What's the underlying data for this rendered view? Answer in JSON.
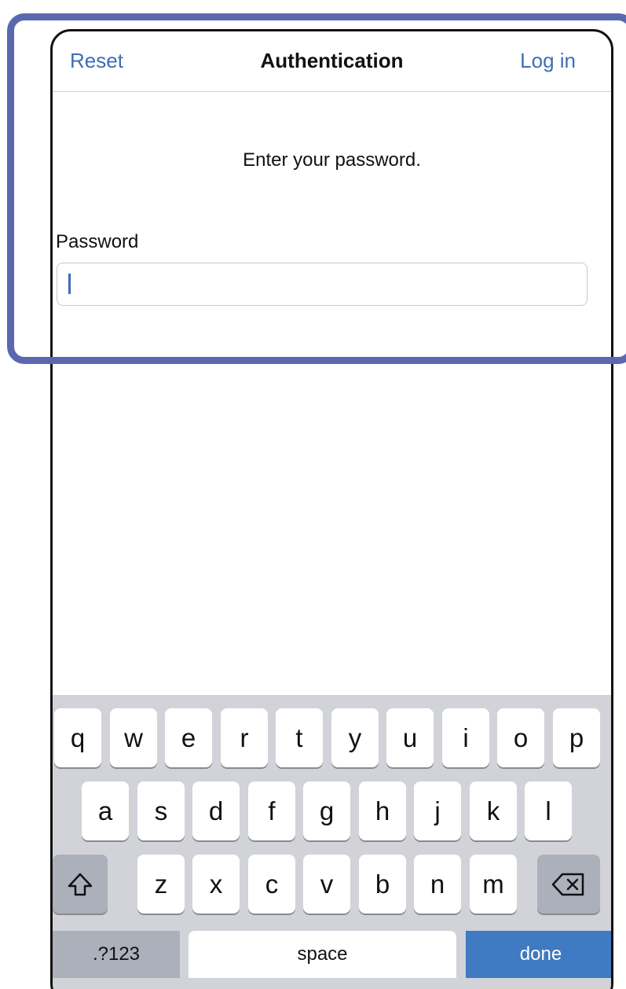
{
  "header": {
    "left_action": "Reset",
    "title": "Authentication",
    "right_action": "Log in"
  },
  "main": {
    "prompt": "Enter your password.",
    "password_label": "Password",
    "password_value": ""
  },
  "keyboard": {
    "row1": [
      "q",
      "w",
      "e",
      "r",
      "t",
      "y",
      "u",
      "i",
      "o",
      "p"
    ],
    "row2": [
      "a",
      "s",
      "d",
      "f",
      "g",
      "h",
      "j",
      "k",
      "l"
    ],
    "row3": [
      "z",
      "x",
      "c",
      "v",
      "b",
      "n",
      "m"
    ],
    "shift_icon": "shift-icon",
    "backspace_icon": "backspace-icon",
    "numbers_label": ".?123",
    "space_label": "space",
    "done_label": "done"
  },
  "colors": {
    "accent": "#3b6fb6",
    "highlight": "#5a68b0",
    "done_key": "#3f7ac2",
    "keyboard_bg": "#d1d3d9"
  }
}
